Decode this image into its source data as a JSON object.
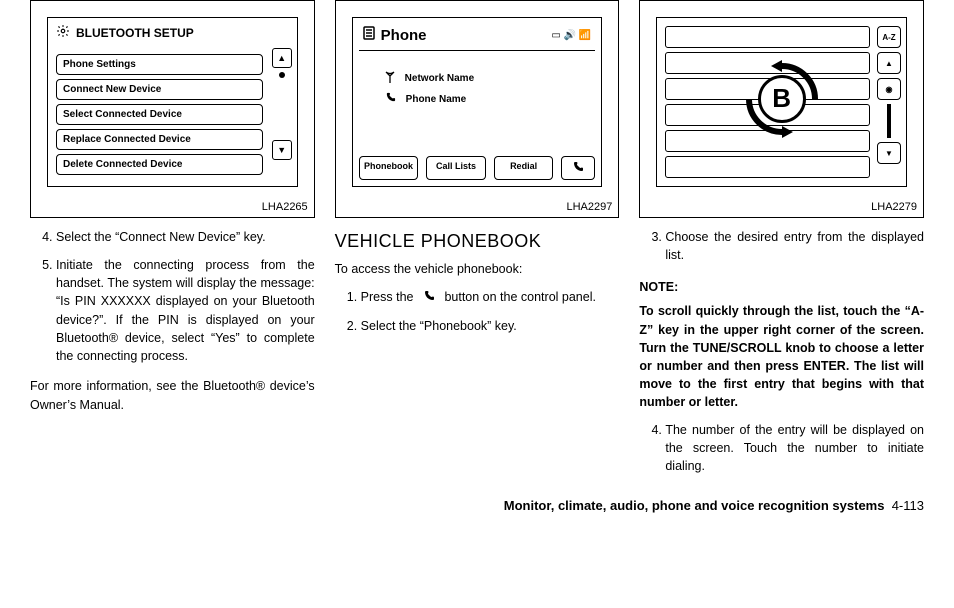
{
  "figures": {
    "bt": {
      "label": "LHA2265",
      "title": "BLUETOOTH SETUP",
      "items": [
        "Phone Settings",
        "Connect New Device",
        "Select Connected Device",
        "Replace Connected Device",
        "Delete Connected Device"
      ]
    },
    "phone": {
      "label": "LHA2297",
      "title": "Phone",
      "lines": [
        "Network Name",
        "Phone Name"
      ],
      "buttons": [
        "Phonebook",
        "Call Lists",
        "Redial"
      ]
    },
    "list": {
      "label": "LHA2279",
      "az": "A-Z",
      "letter": "B"
    }
  },
  "col1": {
    "step4": "Select the “Connect New Device” key.",
    "step5": "Initiate the connecting process from the handset. The system will display the message: “Is PIN XXXXXX displayed on your Bluetooth device?”. If the PIN is displayed on your Bluetooth® device, select “Yes” to complete the connecting process.",
    "more": "For more information, see the Bluetooth® device’s Owner’s Manual."
  },
  "col2": {
    "title": "VEHICLE PHONEBOOK",
    "intro": "To access the vehicle phonebook:",
    "step1a": "Press the",
    "step1b": "button on the control panel.",
    "step2": "Select the “Phonebook” key."
  },
  "col3": {
    "step3": "Choose the desired entry from the displayed list.",
    "note_head": "NOTE:",
    "note_body": "To scroll quickly through the list, touch the “A-Z” key in the upper right corner of the screen. Turn the TUNE/SCROLL knob to choose a letter or number and then press ENTER. The list will move to the first entry that begins with that number or letter.",
    "step4": "The number of the entry will be displayed on the screen. Touch the number to initiate dialing."
  },
  "footer": {
    "section": "Monitor, climate, audio, phone and voice recognition systems",
    "page": "4-113"
  }
}
